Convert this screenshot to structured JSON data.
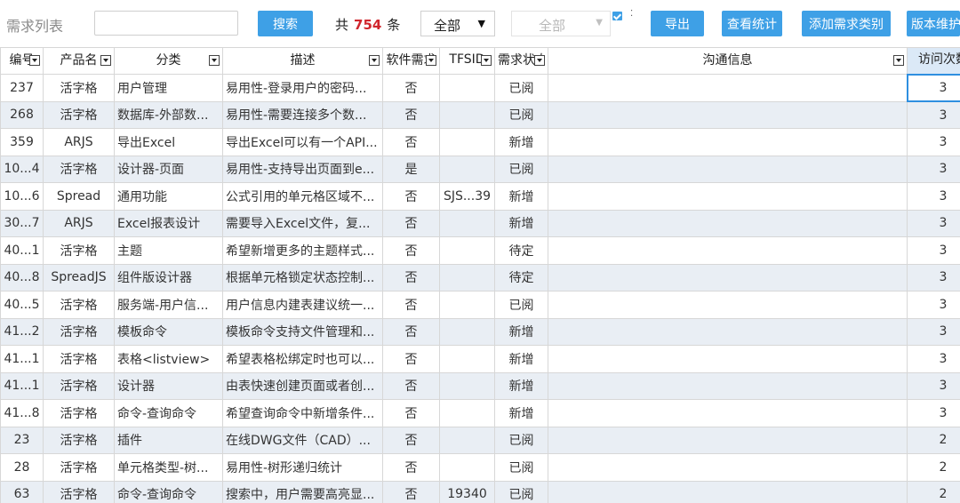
{
  "header": {
    "title": "需求列表",
    "search_placeholder": "",
    "search_button": "搜索",
    "count_prefix": "共",
    "count_value": "754",
    "count_suffix": "条",
    "filter1_value": "全部",
    "filter2_value": "全部",
    "export_button": "导出",
    "stats_button": "查看统计",
    "add_category_button": "添加需求类别",
    "version_button": "版本维护"
  },
  "colors": {
    "accent": "#3ea0e6",
    "count": "#d0262d",
    "stripe": "#e9eef4",
    "selection": "#2f8fe0"
  },
  "columns": [
    {
      "label": "编号"
    },
    {
      "label": "产品名"
    },
    {
      "label": "分类"
    },
    {
      "label": "描述"
    },
    {
      "label": "软件需求"
    },
    {
      "label": "TFSID"
    },
    {
      "label": "需求状态"
    },
    {
      "label": "沟通信息"
    },
    {
      "label": "访问次数"
    }
  ],
  "rows": [
    {
      "id": "237",
      "product": "活字格",
      "category": "用户管理",
      "desc": "易用性-登录用户的密码...",
      "software": "否",
      "tfsid": "",
      "status": "已阅",
      "comm": "",
      "visits": "3"
    },
    {
      "id": "268",
      "product": "活字格",
      "category": "数据库-外部数...",
      "desc": "易用性-需要连接多个数...",
      "software": "否",
      "tfsid": "",
      "status": "已阅",
      "comm": "",
      "visits": "3"
    },
    {
      "id": "359",
      "product": "ARJS",
      "category": "导出Excel",
      "desc": "导出Excel可以有一个API...",
      "software": "否",
      "tfsid": "",
      "status": "新增",
      "comm": "",
      "visits": "3"
    },
    {
      "id": "10...4",
      "product": "活字格",
      "category": "设计器-页面",
      "desc": "易用性-支持导出页面到e...",
      "software": "是",
      "tfsid": "",
      "status": "已阅",
      "comm": "",
      "visits": "3"
    },
    {
      "id": "10...6",
      "product": "Spread",
      "category": "通用功能",
      "desc": "公式引用的单元格区域不...",
      "software": "否",
      "tfsid": "SJS...39",
      "status": "新增",
      "comm": "",
      "visits": "3"
    },
    {
      "id": "30...7",
      "product": "ARJS",
      "category": "Excel报表设计",
      "desc": "需要导入Excel文件，复...",
      "software": "否",
      "tfsid": "",
      "status": "新增",
      "comm": "",
      "visits": "3"
    },
    {
      "id": "40...1",
      "product": "活字格",
      "category": "主题",
      "desc": "希望新增更多的主题样式...",
      "software": "否",
      "tfsid": "",
      "status": "待定",
      "comm": "",
      "visits": "3"
    },
    {
      "id": "40...8",
      "product": "SpreadJS",
      "category": "组件版设计器",
      "desc": "根据单元格锁定状态控制...",
      "software": "否",
      "tfsid": "",
      "status": "待定",
      "comm": "",
      "visits": "3"
    },
    {
      "id": "40...5",
      "product": "活字格",
      "category": "服务端-用户信...",
      "desc": "用户信息内建表建议统一...",
      "software": "否",
      "tfsid": "",
      "status": "已阅",
      "comm": "",
      "visits": "3"
    },
    {
      "id": "41...2",
      "product": "活字格",
      "category": "模板命令",
      "desc": "模板命令支持文件管理和...",
      "software": "否",
      "tfsid": "",
      "status": "新增",
      "comm": "",
      "visits": "3"
    },
    {
      "id": "41...1",
      "product": "活字格",
      "category": "表格<listview>",
      "desc": "希望表格松绑定时也可以...",
      "software": "否",
      "tfsid": "",
      "status": "新增",
      "comm": "",
      "visits": "3"
    },
    {
      "id": "41...1",
      "product": "活字格",
      "category": "设计器",
      "desc": "由表快速创建页面或者创...",
      "software": "否",
      "tfsid": "",
      "status": "新增",
      "comm": "",
      "visits": "3"
    },
    {
      "id": "41...8",
      "product": "活字格",
      "category": "命令-查询命令",
      "desc": "希望查询命令中新增条件...",
      "software": "否",
      "tfsid": "",
      "status": "新增",
      "comm": "",
      "visits": "3"
    },
    {
      "id": "23",
      "product": "活字格",
      "category": "插件",
      "desc": "在线DWG文件（CAD）...",
      "software": "否",
      "tfsid": "",
      "status": "已阅",
      "comm": "",
      "visits": "2"
    },
    {
      "id": "28",
      "product": "活字格",
      "category": "单元格类型-树...",
      "desc": "易用性-树形递归统计",
      "software": "否",
      "tfsid": "",
      "status": "已阅",
      "comm": "",
      "visits": "2"
    },
    {
      "id": "63",
      "product": "活字格",
      "category": "命令-查询命令",
      "desc": "搜索中，用户需要高亮显...",
      "software": "否",
      "tfsid": "19340",
      "status": "已阅",
      "comm": "",
      "visits": "2"
    }
  ]
}
